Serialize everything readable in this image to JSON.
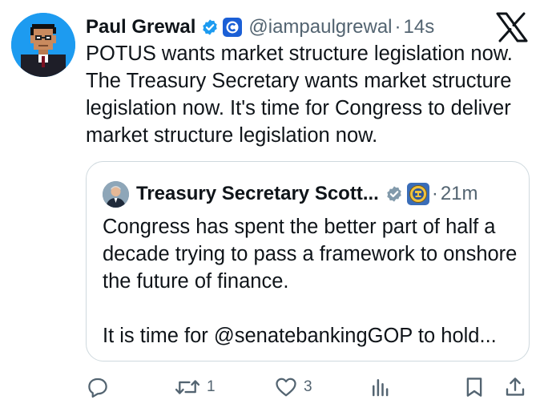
{
  "tweet": {
    "author_name": "Paul Grewal",
    "handle": "@iampaulgrewal",
    "separator": "·",
    "time": "14s",
    "text": "POTUS wants market structure legislation now. The Treasury Secretary wants market structure legislation now. It's time for Congress to deliver market structure legislation now."
  },
  "quote": {
    "author_name": "Treasury Secretary Scott...",
    "separator": "·",
    "time": "21m",
    "paragraph1": "Congress has spent the better part of half a decade trying to pass a framework to onshore the future of finance.",
    "paragraph2": "It is time for @senatebankingGOP to hold..."
  },
  "actions": {
    "reply_icon": "reply-icon",
    "retweet_icon": "retweet-icon",
    "retweet_count": "1",
    "like_icon": "heart-icon",
    "like_count": "3",
    "views_icon": "views-icon",
    "bookmark_icon": "bookmark-icon",
    "share_icon": "share-icon"
  },
  "colors": {
    "accent": "#1d9bf0",
    "text": "#0f1419",
    "secondary": "#536471",
    "border": "#cfd9de"
  }
}
